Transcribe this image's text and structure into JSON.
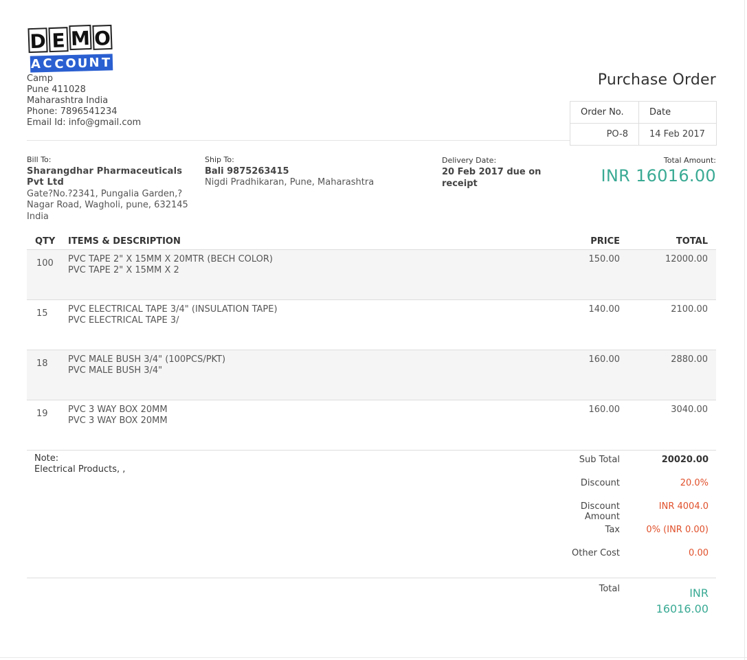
{
  "logo": {
    "line1": "DEMO",
    "line2": "ACCOUNT"
  },
  "company": {
    "address_lines": [
      "Camp",
      "Pune 411028",
      "Maharashtra India",
      "Phone: 7896541234",
      "Email Id: info@gmail.com"
    ]
  },
  "document": {
    "title": "Purchase Order"
  },
  "order_box": {
    "order_no_label": "Order No.",
    "date_label": "Date",
    "order_no": "PO-8",
    "date": "14 Feb 2017"
  },
  "bill_to": {
    "label": "Bill To:",
    "name": "Sharangdhar Pharmaceuticals Pvt Ltd",
    "address": "Gate?No.?2341, Pungalia Garden,? Nagar Road, Wagholi, pune, 632145 India"
  },
  "ship_to": {
    "label": "Ship To:",
    "name": "Bali 9875263415",
    "address": "Nigdi Pradhikaran, Pune, Maharashtra"
  },
  "delivery": {
    "label": "Delivery Date:",
    "value": "20 Feb 2017 due on receipt"
  },
  "total_amount": {
    "label": "Total Amount:",
    "value": "INR 16016.00"
  },
  "items_header": {
    "qty": "QTY",
    "desc": "ITEMS & DESCRIPTION",
    "price": "PRICE",
    "total": "TOTAL"
  },
  "items": [
    {
      "qty": "100",
      "name": "PVC TAPE 2\" X 15MM X 20MTR (BECH COLOR)",
      "desc": "PVC TAPE 2\" X 15MM X 2",
      "price": "150.00",
      "total": "12000.00"
    },
    {
      "qty": "15",
      "name": "PVC ELECTRICAL TAPE 3/4\" (INSULATION TAPE)",
      "desc": "PVC ELECTRICAL TAPE 3/",
      "price": "140.00",
      "total": "2100.00"
    },
    {
      "qty": "18",
      "name": "PVC MALE BUSH 3/4\" (100PCS/PKT)",
      "desc": "PVC MALE BUSH 3/4\"",
      "price": "160.00",
      "total": "2880.00"
    },
    {
      "qty": "19",
      "name": "PVC 3 WAY BOX 20MM",
      "desc": "PVC 3 WAY BOX 20MM",
      "price": "160.00",
      "total": "3040.00"
    }
  ],
  "note": {
    "label": "Note:",
    "text": "Electrical Products, ,"
  },
  "summary": {
    "sub_total_label": "Sub Total",
    "sub_total": "20020.00",
    "discount_label": "Discount",
    "discount": "20.0%",
    "discount_amount_label_1": "Discount",
    "discount_amount_label_2": "Amount",
    "discount_amount": "INR 4004.0",
    "tax_label": "Tax",
    "tax": "0% (INR 0.00)",
    "other_cost_label": "Other Cost",
    "other_cost": "0.00",
    "total_label": "Total",
    "total_currency": "INR",
    "total_value": "16016.00"
  },
  "colors": {
    "accent": "#3aaa94",
    "discount": "#e0502b",
    "logo_blue": "#2a5fd1"
  }
}
